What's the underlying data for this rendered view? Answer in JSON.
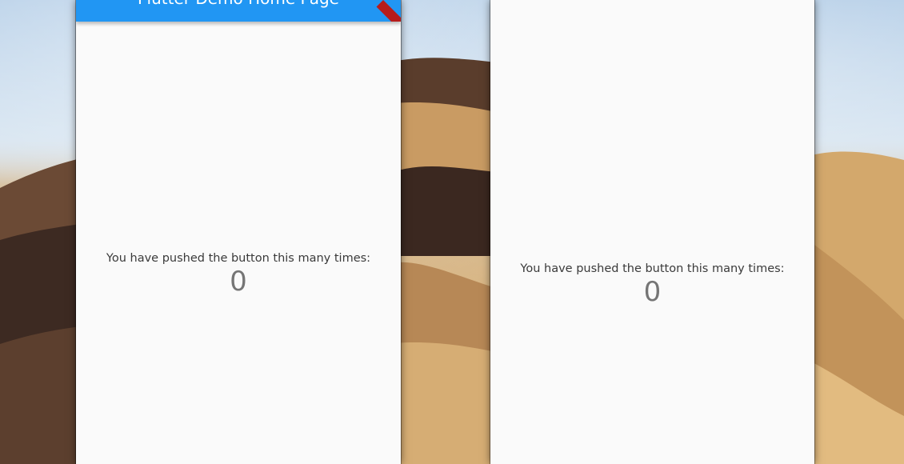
{
  "left_window": {
    "appbar_title": "Flutter Demo Home Page",
    "counter_label": "You have pushed the button this many times:",
    "counter_value": "0",
    "appbar_color": "#2196f3"
  },
  "right_window": {
    "counter_label": "You have pushed the button this many times:",
    "counter_value": "0"
  },
  "colors": {
    "window_background": "#fafafa",
    "debug_banner": "#b71c1c"
  }
}
